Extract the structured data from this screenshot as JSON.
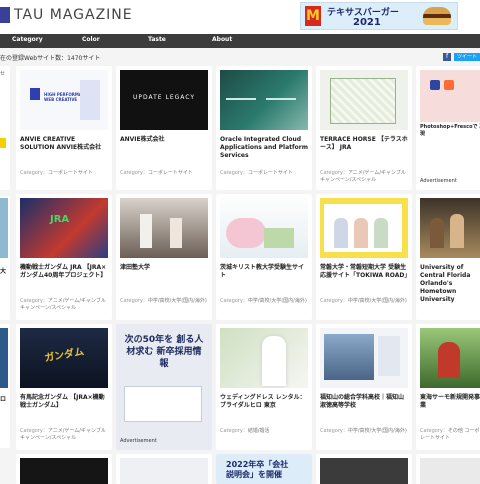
{
  "header": {
    "logo": "TAU MAGAZINE",
    "ad": {
      "line1": "テキサスバーガー",
      "line2": "2021"
    }
  },
  "nav": [
    "Category",
    "Color",
    "Taste",
    "About"
  ],
  "count_text": "在の登録Webサイト数：1470サイト",
  "share": {
    "fb": "f",
    "tw": "ツイート"
  },
  "category_prefix": "Category：",
  "left_fragments": [
    "セ",
    "タ",
    "大",
    "ロ"
  ],
  "cards": [
    {
      "title": "ANVIE CREATIVE SOLUTION ANVIE株式会社",
      "category": "コーポレートサイト",
      "theme": "anvie"
    },
    {
      "title": "ANVIE株式会社",
      "category": "コーポレートサイト",
      "theme": "legacy",
      "thumb_text": "UPDATE LEGACY"
    },
    {
      "title": "Oracle Integrated Cloud Applications and Platform Services",
      "category": "コーポレートサイト",
      "theme": "oracle"
    },
    {
      "title": "TERRACE HORSE 【テラスホース】 JRA",
      "category": "アニメ/ゲーム/ギャンブル キャンペーン/スペシャル",
      "theme": "terrace"
    },
    {
      "title": "Photoshop+Frescoで 再現",
      "category": "",
      "theme": "adobe",
      "is_ad": true,
      "ad_label": "Advertisement"
    },
    {
      "title": "機動戦士ガンダム JRA 【JRA×ガンダム40周年プロジェクト】",
      "category": "アニメ/ゲーム/ギャンブル キャンペーン/スペシャル",
      "theme": "gundam"
    },
    {
      "title": "津田塾大学",
      "category": "中学/高校/大学(国内/海外)",
      "theme": "tsuda"
    },
    {
      "title": "茨城キリスト教大学受験生サイト",
      "category": "中学/高校/大学(国内/海外)",
      "theme": "ibaraki"
    },
    {
      "title": "常磐大学・常磐短期大学 受験生応援サイト「TOKIWA ROAD」",
      "category": "中学/高校/大学(国内/海外)",
      "theme": "tokiwa"
    },
    {
      "title": "University of Central Florida Orlando's Hometown University",
      "category": "",
      "theme": "ucf"
    },
    {
      "title": "有馬記念ガンダム 【JRA×機動戦士ガンダム】",
      "category": "アニメ/ゲーム/ギャンブル キャンペーン/スペシャル",
      "theme": "gundam2"
    },
    {
      "title": "次の50年を 創る人材求む 新卒採用情報",
      "category": "",
      "theme": "recruit",
      "is_ad": true,
      "ad_label": "Advertisement"
    },
    {
      "title": "ウェディングドレス レンタル：ブライダルヒロ 東京",
      "category": "結婚/婚活",
      "theme": "wedding"
    },
    {
      "title": "福知山の総合学科高校｜福知山淑徳高等学校",
      "category": "中学/高校/大学(国内/海外)",
      "theme": "fukuchiyama"
    },
    {
      "title": "東海サーモ新規開発事業",
      "category": "その他 コーポレートサイト",
      "theme": "tokai"
    }
  ],
  "bottom_ad": {
    "line1": "2022年卒「会社",
    "line2": "説明会」を開催"
  }
}
